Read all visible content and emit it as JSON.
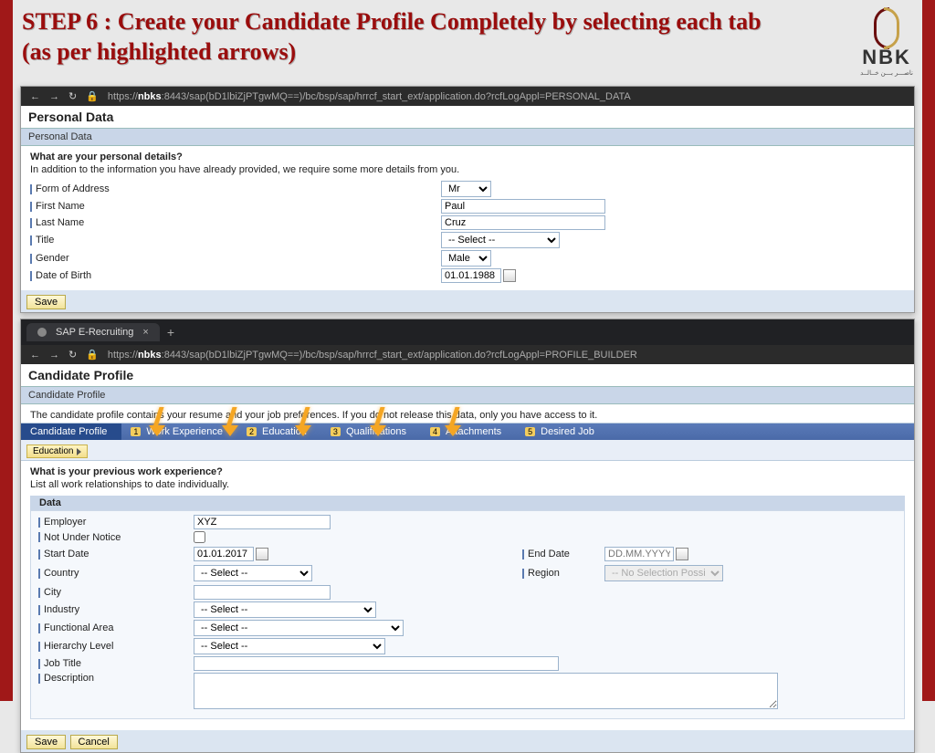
{
  "slide": {
    "title": "STEP 6 : Create your Candidate Profile Completely by selecting each tab (as per highlighted arrows)",
    "logo_text": "NBK",
    "logo_sub": "ـــــــــــــ"
  },
  "page1": {
    "url_prefix": "https://",
    "url_host": "nbks",
    "url_rest": ":8443/sap(bD1lbiZjPTgwMQ==)/bc/bsp/sap/hrrcf_start_ext/application.do?rcfLogAppl=PERSONAL_DATA",
    "section_title": "Personal Data",
    "breadcrumb": "Personal Data",
    "q_heading": "What are your personal details?",
    "q_sub": "In addition to the information you have already provided, we require some more details from you.",
    "labels": {
      "form_of_address": "Form of Address",
      "first_name": "First Name",
      "last_name": "Last Name",
      "title": "Title",
      "gender": "Gender",
      "date_of_birth": "Date of Birth"
    },
    "values": {
      "form_of_address": "Mr",
      "first_name": "Paul",
      "last_name": "Cruz",
      "title": "-- Select --",
      "gender": "Male",
      "date_of_birth": "01.01.1988"
    },
    "save_label": "Save"
  },
  "page2": {
    "tab_label": "SAP E-Recruiting",
    "url_prefix": "https://",
    "url_host": "nbks",
    "url_rest": ":8443/sap(bD1lbiZjPTgwMQ==)/bc/bsp/sap/hrrcf_start_ext/application.do?rcfLogAppl=PROFILE_BUILDER",
    "section_title": "Candidate Profile",
    "breadcrumb": "Candidate Profile",
    "intro": "The candidate profile contains your resume and your job preferences. If you do not release this data, only you have access to it.",
    "tabs": [
      {
        "num": "",
        "label": "Candidate Profile"
      },
      {
        "num": "1",
        "label": "Work Experience"
      },
      {
        "num": "2",
        "label": "Education"
      },
      {
        "num": "3",
        "label": "Qualifications"
      },
      {
        "num": "4",
        "label": "Attachments"
      },
      {
        "num": "5",
        "label": "Desired Job"
      }
    ],
    "sub_chip": "Education",
    "work": {
      "heading": "What is your previous work experience?",
      "sub": "List all work relationships to date individually.",
      "data_header": "Data",
      "labels": {
        "employer": "Employer",
        "not_under_notice": "Not Under Notice",
        "start_date": "Start Date",
        "end_date": "End Date",
        "country": "Country",
        "region": "Region",
        "city": "City",
        "industry": "Industry",
        "functional_area": "Functional Area",
        "hierarchy_level": "Hierarchy Level",
        "job_title": "Job Title",
        "description": "Description"
      },
      "values": {
        "employer": "XYZ",
        "not_under_notice": false,
        "start_date": "01.01.2017",
        "end_date_placeholder": "DD.MM.YYYY",
        "country": "-- Select --",
        "region_placeholder": "-- No Selection Possible --",
        "city": "",
        "industry": "-- Select --",
        "functional_area": "-- Select --",
        "hierarchy_level": "-- Select --",
        "job_title": "",
        "description": ""
      }
    },
    "save_label": "Save",
    "cancel_label": "Cancel"
  }
}
